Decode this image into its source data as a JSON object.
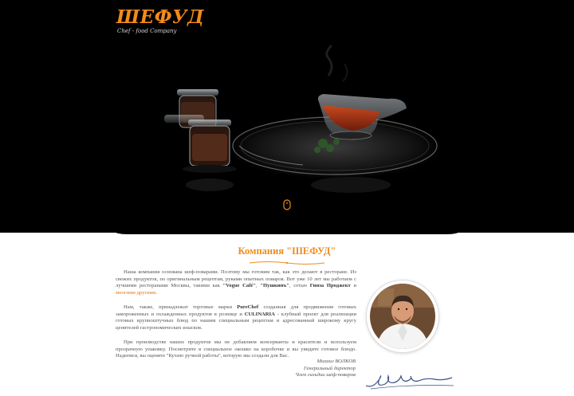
{
  "logo": {
    "text": "ШЕФУД",
    "subtitle": "Chef - food Company"
  },
  "icons": {
    "scroll": "mouse-scroll-icon",
    "logo": "chef-logo"
  },
  "colors": {
    "accent": "#f08c1e",
    "hero_background": "#000000",
    "text": "#555555"
  },
  "section": {
    "heading": "Компания \"ШЕФУД\""
  },
  "paragraphs": {
    "p1_a": "Наша компания основана шеф-поварами. Поэтому мы готовим так, как это делают в ресторане. Из свежих продуктов, по оригинальным рецептам, руками опытных поваров. Вот уже 10 лет мы работаем с лучшими ресторанами Москвы, такими как ",
    "p1_b1": "\"Vogue Café\"",
    "p1_c": ", ",
    "p1_b2": "\"Пушкинъ\"",
    "p1_d": ", сетью ",
    "p1_b3": "Гинза Проджект",
    "p1_e": " и ",
    "p1_link": "многими другими",
    "p1_f": ".",
    "p2_a": "Нам, также, принадлежат торговые марки ",
    "p2_b1": "PureChef",
    "p2_c": " созданная для продвижения готовых замороженных и охлажденных продуктов в рознице и ",
    "p2_b2": "CULINARIA",
    "p2_d": " - клубный проект для реализации готовых крупноштучных блюд по нашим специальным рецептам и адресованный широкому кругу ценителей гастрономических изысков.",
    "p3": "При производстве наших продуктов мы не добавляем консерванты и красители и используем прозрачную упаковку. Посмотрите в специальное окошко на коробочке и вы увидите готовое блюдо. Надеемся, вы оцените \"Кухню ручной работы\", которую мы создали для Вас."
  },
  "signature": {
    "name": "Михаил ВОЛКОВ",
    "position": "Генеральный директор",
    "membership": "Член гильдии шеф-поваров"
  }
}
